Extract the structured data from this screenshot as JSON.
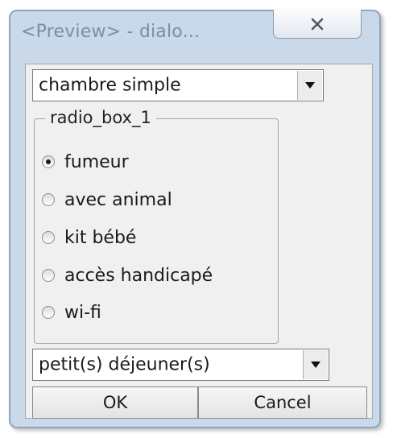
{
  "window": {
    "title": "<Preview> - dialo...",
    "close_symbol": "✕"
  },
  "combo_room": {
    "value": "chambre simple",
    "icon": "dropdown-arrow-icon"
  },
  "radio_group": {
    "label": "radio_box_1",
    "options": [
      {
        "label": "fumeur",
        "selected": true
      },
      {
        "label": "avec animal",
        "selected": false
      },
      {
        "label": "kit bébé",
        "selected": false
      },
      {
        "label": "accès handicapé",
        "selected": false
      },
      {
        "label": "wi-fi",
        "selected": false
      }
    ]
  },
  "combo_breakfast": {
    "value": "petit(s) déjeuner(s)",
    "icon": "dropdown-arrow-icon"
  },
  "buttons": {
    "ok": "OK",
    "cancel": "Cancel"
  },
  "colors": {
    "frame": "#c9d9ea",
    "client": "#f0f0f0",
    "title_text": "#7d8da3"
  }
}
